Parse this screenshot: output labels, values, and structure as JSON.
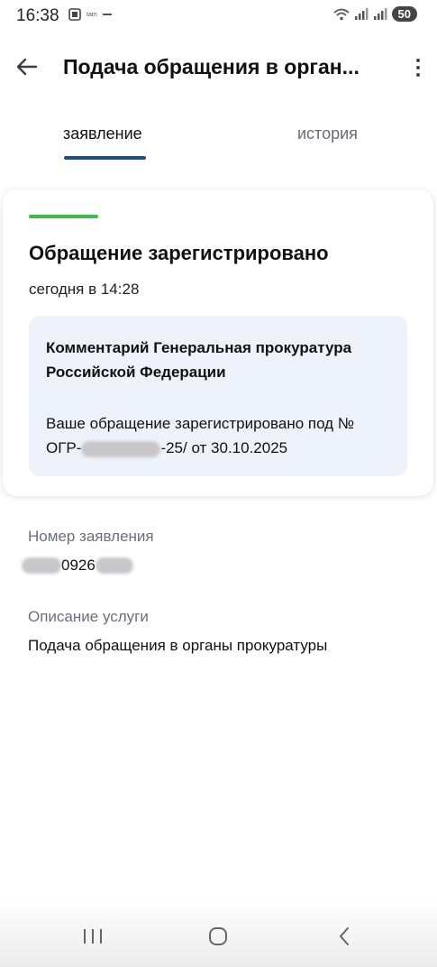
{
  "status_bar": {
    "time": "16:38",
    "mini_label": "tam",
    "battery": "50"
  },
  "header": {
    "title": "Подача обращения в орган..."
  },
  "tabs": [
    {
      "label": "заявление",
      "active": true
    },
    {
      "label": "история",
      "active": false
    }
  ],
  "card": {
    "status_color": "#3fb84f",
    "title": "Обращение зарегистрировано",
    "time": "сегодня в 14:28",
    "comment_title": "Комментарий Генеральная прокуратура Российской Федерации",
    "comment_text_line1": "Ваше обращение зарегистрировано под №",
    "comment_text_prefix": "ОГР-",
    "comment_text_suffix": "-25/ от 30.10.2025"
  },
  "fields": {
    "number_label": "Номер заявления",
    "number_visible": "0926",
    "service_label": "Описание услуги",
    "service_value": "Подача обращения в органы прокуратуры"
  },
  "colors": {
    "accent": "#1d4b8f",
    "comment_bg": "#eef3fb"
  }
}
